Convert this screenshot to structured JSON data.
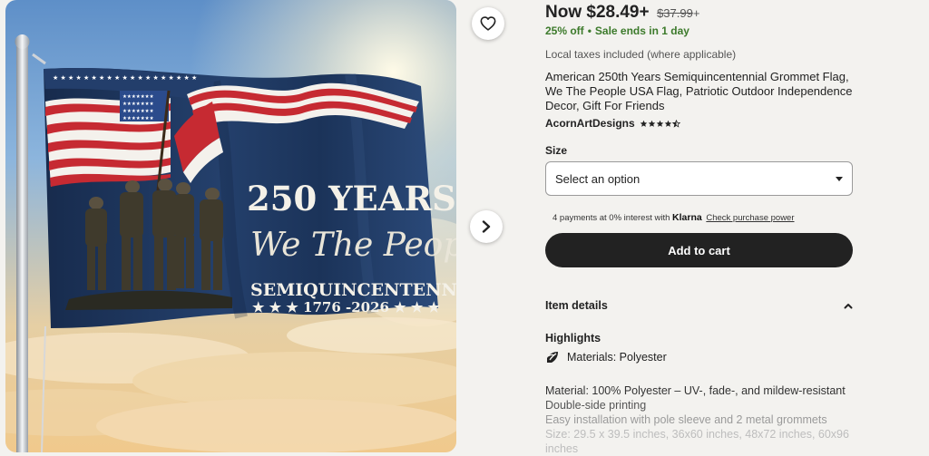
{
  "listing": {
    "price": {
      "now_label": "Now $28.49",
      "now_plus": "+",
      "original": "$37.99",
      "original_plus": "+"
    },
    "sale": {
      "discount": "25% off",
      "separator": "•",
      "ends": "Sale ends in 1 day"
    },
    "tax_note": "Local taxes included (where applicable)",
    "title": "American 250th Years Semiquincentennial Grommet Flag, We The People USA Flag, Patriotic Outdoor Independence Decor, Gift For Friends",
    "seller": {
      "name": "AcornArtDesigns",
      "rating": 4.5,
      "star_icons": [
        "star-icon",
        "star-icon",
        "star-icon",
        "star-icon",
        "half-star-icon"
      ]
    }
  },
  "image": {
    "flag_line1": "250 YEARS",
    "flag_line2": "We The People",
    "flag_line3": "SEMIQUINCENTENNIAL",
    "flag_line4": "★ ★ ★ 1776 -2026 ★ ★ ★",
    "favorite_icon": "heart-icon",
    "next_icon": "chevron-right-icon"
  },
  "options": {
    "size_label": "Size",
    "size_select_value": "Select an option"
  },
  "payment": {
    "klarna_text": "4 payments at 0% interest with",
    "klarna_brand": "Klarna",
    "klarna_link": "Check purchase power"
  },
  "cart": {
    "add_to_cart_label": "Add to cart"
  },
  "item_details": {
    "heading": "Item details",
    "highlights_heading": "Highlights",
    "materials_icon": "material-icon",
    "materials": "Materials: Polyester",
    "description": [
      "Material: 100% Polyester – UV-, fade-, and mildew-resistant",
      "Double-side printing",
      "Easy installation with pole sleeve and 2 metal grommets",
      "Size: 29.5 x 39.5 inches, 36x60 inches, 48x72 inches, 60x96 inches"
    ]
  },
  "colors": {
    "sale_green": "#3c7a2b",
    "button_dark": "#222222",
    "background": "#f3f2ef",
    "flag_navy": "#1d3358",
    "flag_red": "#c62a32"
  }
}
